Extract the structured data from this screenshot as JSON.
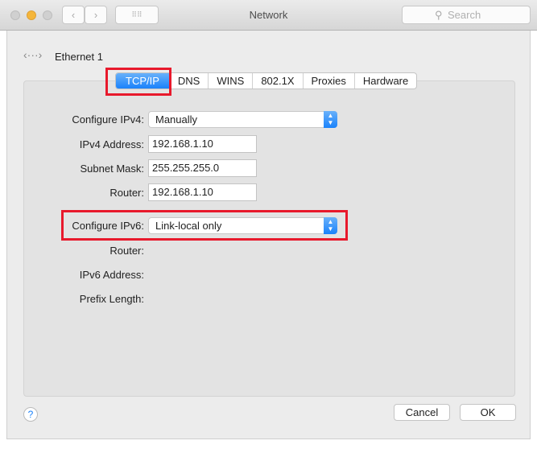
{
  "window": {
    "title": "Network",
    "search_placeholder": "Search"
  },
  "interface": {
    "name": "Ethernet 1"
  },
  "tabs": [
    {
      "label": "TCP/IP",
      "active": true
    },
    {
      "label": "DNS"
    },
    {
      "label": "WINS"
    },
    {
      "label": "802.1X"
    },
    {
      "label": "Proxies"
    },
    {
      "label": "Hardware"
    }
  ],
  "ipv4": {
    "configure_label": "Configure IPv4:",
    "configure_value": "Manually",
    "address_label": "IPv4 Address:",
    "address_value": "192.168.1.10",
    "subnet_label": "Subnet Mask:",
    "subnet_value": "255.255.255.0",
    "router_label": "Router:",
    "router_value": "192.168.1.10"
  },
  "ipv6": {
    "configure_label": "Configure IPv6:",
    "configure_value": "Link-local only",
    "router_label": "Router:",
    "address_label": "IPv6 Address:",
    "prefix_label": "Prefix Length:"
  },
  "buttons": {
    "help": "?",
    "cancel": "Cancel",
    "ok": "OK"
  },
  "colors": {
    "accent": "#1a82fb",
    "highlight": "#e8192c"
  }
}
